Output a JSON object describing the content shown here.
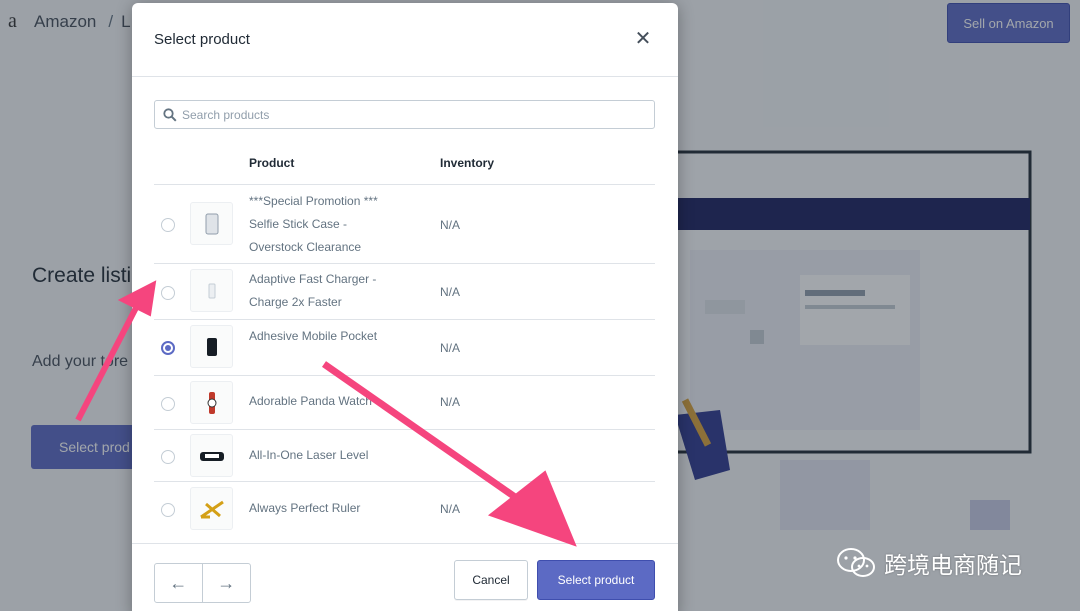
{
  "background": {
    "logo": "a",
    "breadcrumb": {
      "root": "Amazon",
      "separator": "/",
      "current": "L"
    },
    "sell_button": "Sell on Amazon",
    "hero": {
      "title": "Create listi Amazon.c",
      "description": "Add your tore products othe",
      "button": "Select prod"
    }
  },
  "modal": {
    "title": "Select product",
    "close_icon": "close-icon",
    "search": {
      "placeholder": "Search products",
      "value": ""
    },
    "columns": [
      "Product",
      "Inventory"
    ],
    "rows": [
      {
        "name": "***Special Promotion *** Selfie Stick Case - Overstock Clearance",
        "inventory": "N/A",
        "selected": false
      },
      {
        "name": "Adaptive Fast Charger - Charge 2x Faster",
        "inventory": "N/A",
        "selected": false
      },
      {
        "name": "Adhesive Mobile Pocket",
        "inventory": "N/A",
        "selected": true
      },
      {
        "name": "Adorable Panda Watch",
        "inventory": "N/A",
        "selected": false
      },
      {
        "name": "All-In-One Laser Level",
        "inventory": "",
        "selected": false
      },
      {
        "name": "Always Perfect Ruler",
        "inventory": "N/A",
        "selected": false
      }
    ],
    "footer": {
      "prev_icon": "arrow-left-icon",
      "next_icon": "arrow-right-icon",
      "cancel": "Cancel",
      "select": "Select product"
    }
  },
  "annotation": {
    "color": "#f5457e"
  },
  "watermark": {
    "text": "跨境电商随记",
    "icon": "wechat-icon"
  },
  "colors": {
    "accent": "#5c6ac4",
    "border": "#c4cdd5",
    "text_muted": "#637381"
  }
}
